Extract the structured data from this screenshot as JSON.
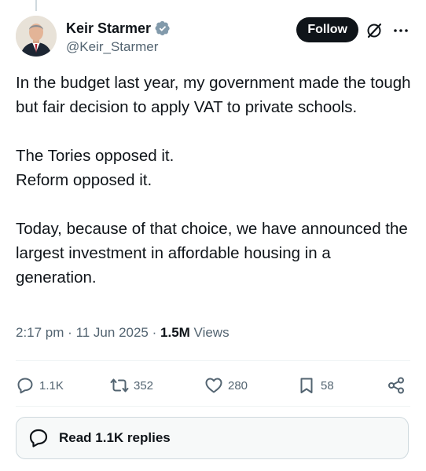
{
  "author": {
    "display_name": "Keir Starmer",
    "handle": "@Keir_Starmer",
    "verified": true
  },
  "header": {
    "follow_label": "Follow"
  },
  "tweet": {
    "paragraphs": [
      "In the budget last year, my government made the tough but fair decision to apply VAT to private schools.",
      "The Tories opposed it.\nReform opposed it.",
      "Today, because of that choice, we have announced the largest investment in affordable housing in a generation."
    ],
    "time": "2:17 pm",
    "date": "11 Jun 2025",
    "views_count": "1.5M",
    "views_label": "Views"
  },
  "actions": {
    "replies": "1.1K",
    "reposts": "352",
    "likes": "280",
    "bookmarks": "58"
  },
  "replies_button": {
    "label": "Read 1.1K replies"
  },
  "icons": {
    "verified": "verified-badge-icon",
    "grok": "grok-icon",
    "more": "more-options-icon",
    "reply": "reply-icon",
    "repost": "repost-icon",
    "like": "heart-icon",
    "bookmark": "bookmark-icon",
    "share": "share-icon"
  },
  "colors": {
    "text_primary": "#0f1419",
    "text_secondary": "#536471",
    "follow_button_bg": "#0f1419",
    "follow_button_text": "#ffffff",
    "divider": "#eff3f4",
    "replies_button_bg": "#f7f9f9"
  }
}
